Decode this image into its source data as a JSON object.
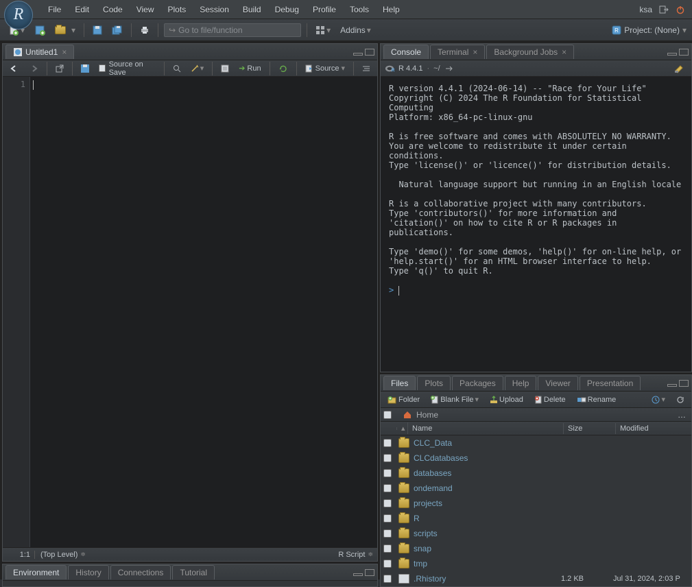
{
  "menu": {
    "items": [
      "File",
      "Edit",
      "Code",
      "View",
      "Plots",
      "Session",
      "Build",
      "Debug",
      "Profile",
      "Tools",
      "Help"
    ]
  },
  "user": "ksa",
  "toolbar": {
    "goto_placeholder": "Go to file/function",
    "addins": "Addins",
    "project": "Project: (None)"
  },
  "source": {
    "tab": "Untitled1",
    "source_on_save": "Source on Save",
    "run": "Run",
    "source_btn": "Source",
    "line": "1",
    "pos": "1:1",
    "scope": "(Top Level)",
    "type": "R Script"
  },
  "console": {
    "tabs": [
      "Console",
      "Terminal",
      "Background Jobs"
    ],
    "rver": "R 4.4.1",
    "wd": "~/",
    "text": "R version 4.4.1 (2024-06-14) -- \"Race for Your Life\"\nCopyright (C) 2024 The R Foundation for Statistical Computing\nPlatform: x86_64-pc-linux-gnu\n\nR is free software and comes with ABSOLUTELY NO WARRANTY.\nYou are welcome to redistribute it under certain conditions.\nType 'license()' or 'licence()' for distribution details.\n\n  Natural language support but running in an English locale\n\nR is a collaborative project with many contributors.\nType 'contributors()' for more information and\n'citation()' on how to cite R or R packages in publications.\n\nType 'demo()' for some demos, 'help()' for on-line help, or\n'help.start()' for an HTML browser interface to help.\nType 'q()' to quit R.\n",
    "prompt": "> "
  },
  "files": {
    "tabs": [
      "Files",
      "Plots",
      "Packages",
      "Help",
      "Viewer",
      "Presentation"
    ],
    "toolbar": {
      "folder": "Folder",
      "blank": "Blank File",
      "upload": "Upload",
      "delete": "Delete",
      "rename": "Rename"
    },
    "breadcrumb": "Home",
    "headers": {
      "name": "Name",
      "size": "Size",
      "modified": "Modified"
    },
    "rows": [
      {
        "name": "CLC_Data",
        "type": "folder",
        "size": "",
        "modified": ""
      },
      {
        "name": "CLCdatabases",
        "type": "folder",
        "size": "",
        "modified": ""
      },
      {
        "name": "databases",
        "type": "folder",
        "size": "",
        "modified": ""
      },
      {
        "name": "ondemand",
        "type": "folder",
        "size": "",
        "modified": ""
      },
      {
        "name": "projects",
        "type": "folder",
        "size": "",
        "modified": ""
      },
      {
        "name": "R",
        "type": "folder",
        "size": "",
        "modified": ""
      },
      {
        "name": "scripts",
        "type": "folder",
        "size": "",
        "modified": ""
      },
      {
        "name": "snap",
        "type": "folder",
        "size": "",
        "modified": ""
      },
      {
        "name": "tmp",
        "type": "folder",
        "size": "",
        "modified": ""
      },
      {
        "name": ".Rhistory",
        "type": "file",
        "size": "1.2 KB",
        "modified": "Jul 31, 2024, 2:03 P"
      }
    ]
  },
  "env": {
    "tabs": [
      "Environment",
      "History",
      "Connections",
      "Tutorial"
    ]
  }
}
